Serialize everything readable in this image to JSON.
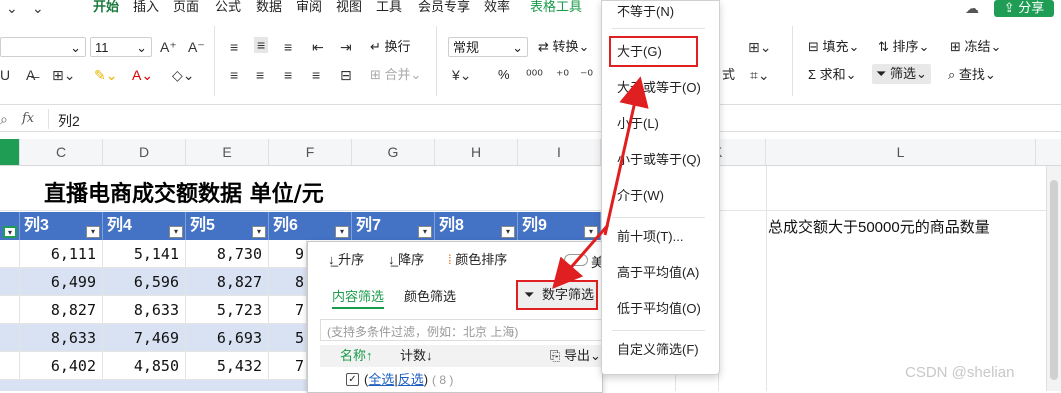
{
  "menubar": {
    "tabs": [
      "开始",
      "插入",
      "页面",
      "公式",
      "数据",
      "审阅",
      "视图",
      "工具",
      "会员专享",
      "效率",
      "表格工具"
    ],
    "share_label": "分享"
  },
  "ribbon": {
    "font_size": "11",
    "number_format": "常规",
    "wrap": "换行",
    "convert": "转换",
    "merge": "合并",
    "percent": "%",
    "fill": "填充",
    "sort": "排序",
    "freeze": "冻结",
    "sum": "求和",
    "filter": "筛选",
    "find": "查找",
    "style_partial": "式"
  },
  "formula_bar": {
    "fx": "fx",
    "value": "列2",
    "name_box_icon": "search-icon"
  },
  "columns": [
    "C",
    "D",
    "E",
    "F",
    "G",
    "H",
    "I",
    "K",
    "L"
  ],
  "sheet": {
    "title": "直播电商成交额数据 单位/元",
    "headers": [
      "列3",
      "列4",
      "列5",
      "列6",
      "列7",
      "列8",
      "列9"
    ],
    "rows": [
      [
        "6,111",
        "5,141",
        "8,730",
        "9"
      ],
      [
        "6,499",
        "6,596",
        "8,827",
        "8"
      ],
      [
        "8,827",
        "8,633",
        "5,723",
        "7"
      ],
      [
        "8,633",
        "7,469",
        "6,693",
        "5"
      ],
      [
        "6,402",
        "4,850",
        "5,432",
        "7"
      ],
      [
        "",
        "",
        "",
        ""
      ]
    ],
    "note": "总成交额大于50000元的商品数量"
  },
  "filter_popup": {
    "sort_asc": "升序",
    "sort_desc": "降序",
    "color_sort": "颜色排序",
    "tab_content": "内容筛选",
    "tab_color": "颜色筛选",
    "number_filter": "数字筛选",
    "search_placeholder": "(支持多条件过滤，例如：北京 上海)",
    "col_name": "名称↑",
    "col_count": "计数↓",
    "export": "导出",
    "select_all": "全选",
    "invert": "反选",
    "count": "( 8 )",
    "toggle_partial": "美"
  },
  "dropdown": {
    "items": [
      "不等于(N)",
      "大于(G)",
      "大于或等于(O)",
      "小于(L)",
      "小于或等于(Q)",
      "介于(W)",
      "前十项(T)...",
      "高于平均值(A)",
      "低于平均值(O)",
      "自定义筛选(F)"
    ]
  },
  "watermark": "CSDN @shelian",
  "colors": {
    "header_blue": "#4472c4",
    "band_blue": "#d9e2f3",
    "accent_green": "#1a7a3c",
    "arrow_red": "#e02020"
  }
}
